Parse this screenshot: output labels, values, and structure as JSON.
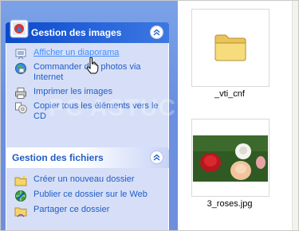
{
  "image_panel": {
    "title": "Gestion des images",
    "tasks": [
      {
        "label": "Afficher un diaporama",
        "icon": "slideshow-icon"
      },
      {
        "label": "Commander des photos via Internet",
        "icon": "order-photos-icon"
      },
      {
        "label": "Imprimer les images",
        "icon": "printer-icon"
      },
      {
        "label": "Copier tous les éléments vers le CD",
        "icon": "copy-to-cd-icon"
      }
    ]
  },
  "file_panel": {
    "title": "Gestion des fichiers",
    "tasks": [
      {
        "label": "Créer un nouveau dossier",
        "icon": "new-folder-icon"
      },
      {
        "label": "Publier ce dossier sur le Web",
        "icon": "publish-web-icon"
      },
      {
        "label": "Partager ce dossier",
        "icon": "share-folder-icon"
      }
    ]
  },
  "files": [
    {
      "name": "_vti_cnf",
      "type": "folder"
    },
    {
      "name": "3_roses.jpg",
      "type": "image"
    }
  ],
  "watermark": "PC ASTUCES",
  "colors": {
    "taskpane_bg": "#7ba2e7",
    "panel_header_special": "#0a49c9",
    "panel_body": "#d6dff7",
    "link": "#215dc6"
  }
}
